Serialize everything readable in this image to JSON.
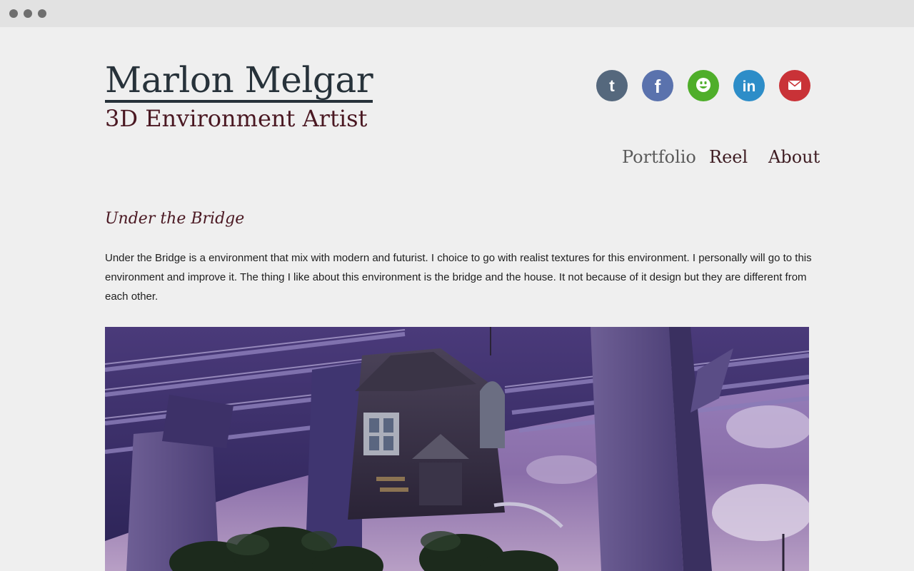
{
  "site": {
    "name": "Marlon Melgar",
    "tagline": "3D Environment Artist"
  },
  "social": [
    {
      "icon": "tumblr-icon",
      "color": "#55687d"
    },
    {
      "icon": "facebook-icon",
      "color": "#5a72ad"
    },
    {
      "icon": "smiley-icon",
      "color": "#4fae2a"
    },
    {
      "icon": "linkedin-icon",
      "color": "#2d8dc8"
    },
    {
      "icon": "mail-icon",
      "color": "#c93237"
    }
  ],
  "nav": {
    "portfolio": "Portfolio",
    "reel": "Reel",
    "about": "About"
  },
  "post": {
    "title": "Under the Bridge",
    "body": "Under the Bridge is a environment that mix with modern and futurist. I choice to go with realist textures for this environment. I personally will go to this environment and improve it. The thing I like about this environment is the bridge and the house. It not because of it design but they are different from each other."
  },
  "colors": {
    "background": "#efefef",
    "title": "#27323a",
    "accent": "#4a1822"
  }
}
